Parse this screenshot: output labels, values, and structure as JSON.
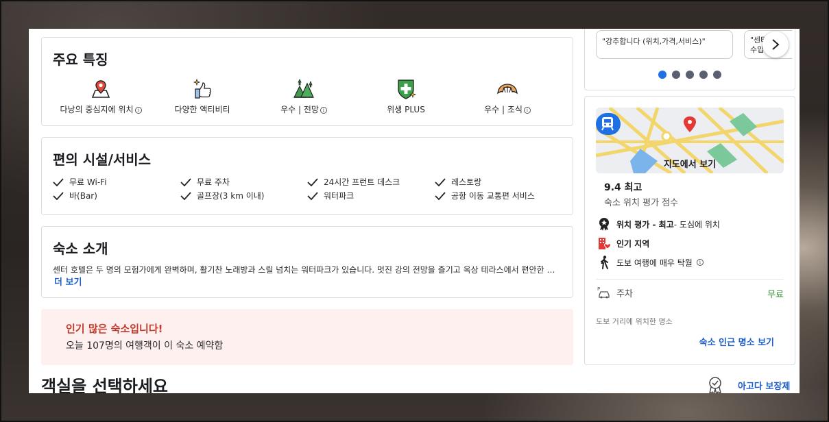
{
  "features": {
    "title": "주요 특징",
    "items": [
      {
        "label": "다낭의 중심지에 위치",
        "info": true,
        "icon": "map-pin-icon"
      },
      {
        "label": "다양한 액티비티",
        "info": false,
        "icon": "thumbs-up-icon"
      },
      {
        "label": "우수 | 전망",
        "info": true,
        "icon": "landscape-icon"
      },
      {
        "label": "위생 PLUS",
        "info": false,
        "icon": "hygiene-shield-icon"
      },
      {
        "label": "우수 | 조식",
        "info": true,
        "icon": "croissant-icon"
      }
    ]
  },
  "amenities": {
    "title": "편의 시설/서비스",
    "items": [
      "무료 Wi-Fi",
      "무료 주차",
      "24시간 프런트 데스크",
      "레스토랑",
      "바(Bar)",
      "골프장(3 km 이내)",
      "워터파크",
      "공항 이동 교통편 서비스"
    ]
  },
  "about": {
    "title": "숙소 소개",
    "description": "센터 호텔은 두 명의 모험가에게 완벽하며, 활기찬 노래방과 스릴 넘치는 워터파크가 있습니다. 멋진 강의 전망을 즐기고 옥상 테라스에서 편안한 시...",
    "more_label": "더 보기"
  },
  "popular": {
    "title": "인기 많은 숙소입니다!",
    "prefix": "오늘 ",
    "count": "107",
    "suffix": "명의 여행객이 이 숙소 예약함"
  },
  "rooms_title": "객실을 선택하세요",
  "reviews": {
    "quote1": "\"강추합니다 (위치,가격,서비스)\"",
    "quote2_line1": "\"센터",
    "quote2_line2": "수입",
    "active_dot": 0,
    "dot_count": 5
  },
  "location": {
    "map_label": "지도에서 보기",
    "score": "9.4 최고",
    "score_caption": "숙소 위치 평가 점수",
    "rating_bold": "위치 평가 - 최고",
    "rating_rest": " - 도심에 위치",
    "popular_area": "인기 지역",
    "walkable": "도보 여행에 매우 탁월",
    "parking_label": "주차",
    "parking_value": "무료",
    "nearby_caption": "도보 거리에 위치한 명소",
    "nearby_link": "숙소 인근 명소 보기"
  },
  "guarantee_label": "아고다 보장제",
  "colors": {
    "link": "#1d5fc9",
    "accent_blue": "#1f6fe5",
    "free_green": "#2e8b2e",
    "popular_red": "#c23a2b",
    "popular_bg": "#fdf0ee"
  }
}
